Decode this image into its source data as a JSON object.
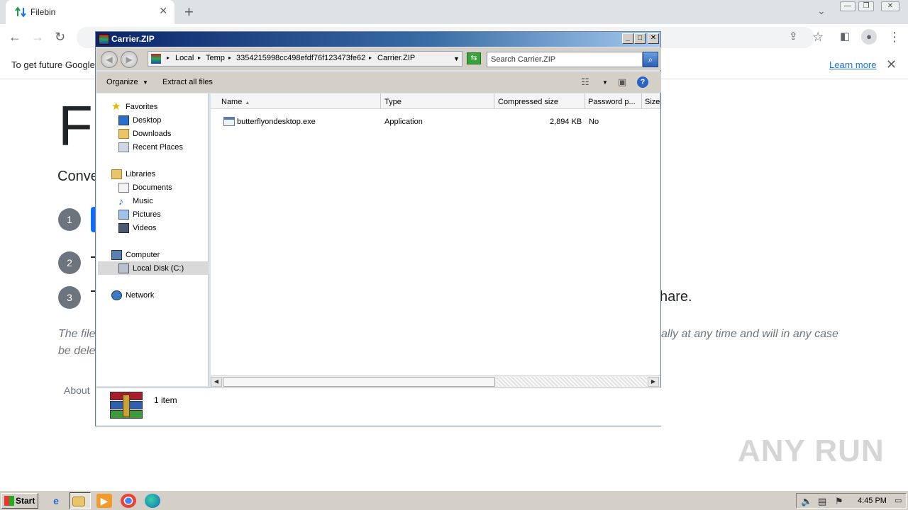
{
  "browser": {
    "tab_title": "Filebin",
    "infobar_text": "To get future Google",
    "learn_more": "Learn more"
  },
  "page": {
    "title_partial": "Fi",
    "subtitle_partial": "Conve",
    "steps": [
      "1",
      "2",
      "3"
    ],
    "share_tail": "hare.",
    "italic_line1_left": "The file",
    "italic_line1_right": "ally at any time and will in any case",
    "italic_line2": "be dele",
    "about": "About",
    "watermark": "ANY RUN"
  },
  "rar": {
    "title": "Carrier.ZIP",
    "breadcrumbs": [
      "Local",
      "Temp",
      "3354215998cc498efdf76f123473fe62",
      "Carrier.ZIP"
    ],
    "search_placeholder": "Search Carrier.ZIP",
    "organize": "Organize",
    "extract_all": "Extract all files",
    "nav": {
      "favorites": "Favorites",
      "desktop": "Desktop",
      "downloads": "Downloads",
      "recent_places": "Recent Places",
      "libraries": "Libraries",
      "documents": "Documents",
      "music": "Music",
      "pictures": "Pictures",
      "videos": "Videos",
      "computer": "Computer",
      "local_disk": "Local Disk (C:)",
      "network": "Network"
    },
    "columns": {
      "name": "Name",
      "type": "Type",
      "compressed_size": "Compressed size",
      "password": "Password p...",
      "size": "Size"
    },
    "file": {
      "name": "butterflyondesktop.exe",
      "type": "Application",
      "compressed_size": "2,894 KB",
      "password": "No"
    },
    "item_count": "1 item"
  },
  "taskbar": {
    "start": "Start",
    "clock": "4:45 PM"
  },
  "colors": {
    "title_gradient_start": "#0a246a",
    "link_blue": "#1a73e8",
    "step_gray": "#6c757d"
  }
}
